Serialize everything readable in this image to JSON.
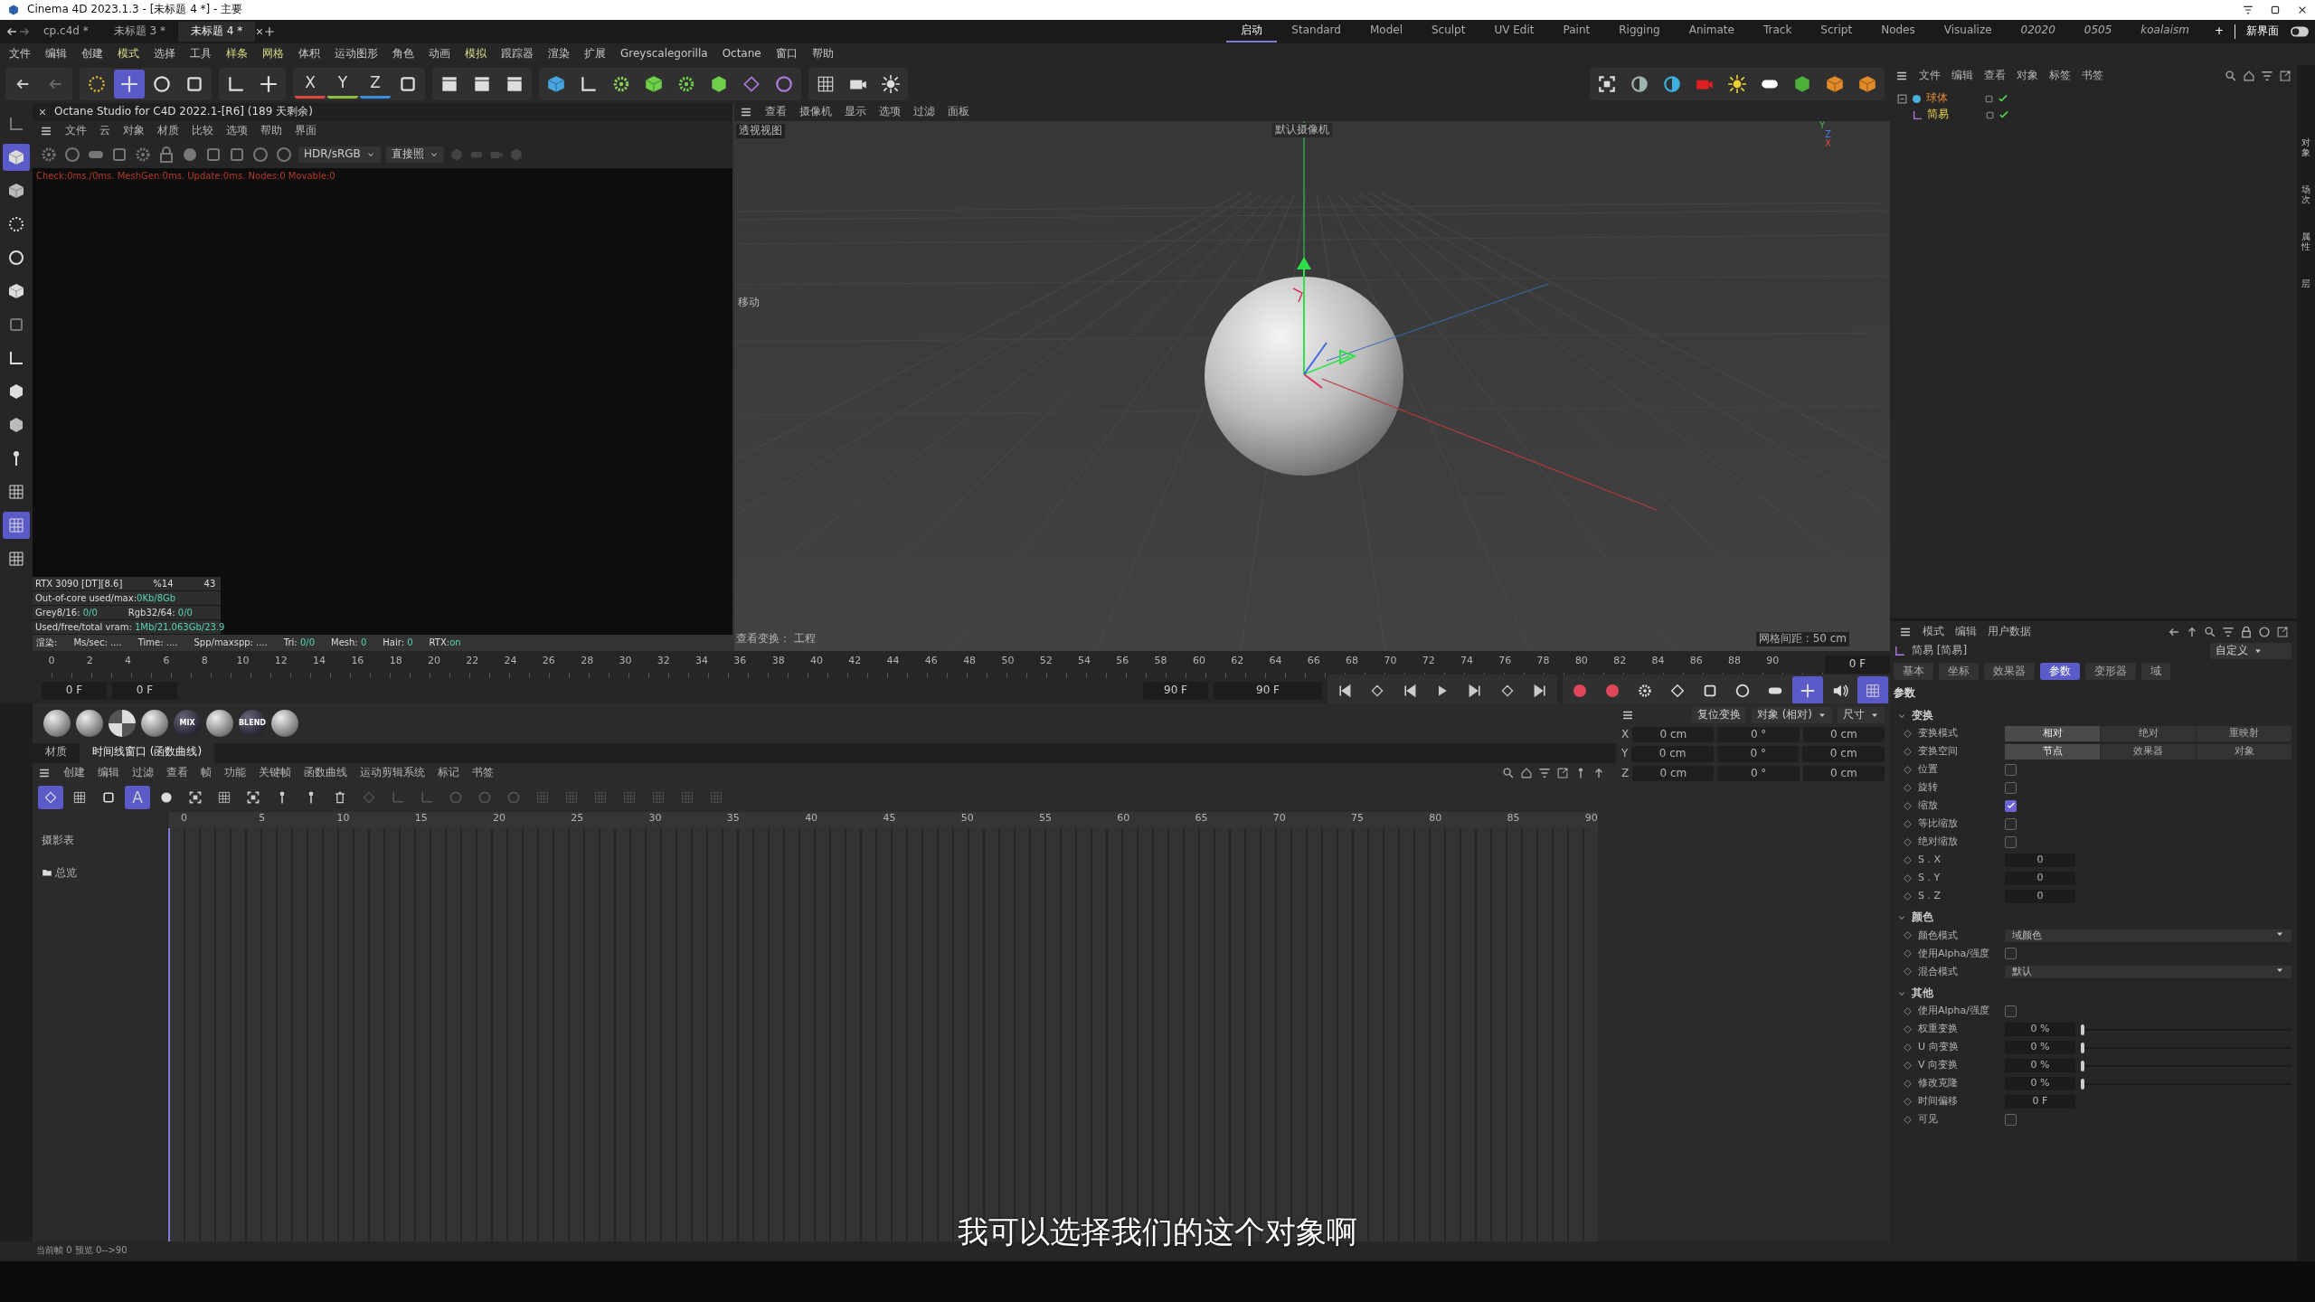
{
  "title_bar": {
    "title": "Cinema 4D 2023.1.3 - [未标题 4 *] - 主要"
  },
  "doc_tabs": [
    {
      "label": "cp.c4d *",
      "selected": false
    },
    {
      "label": "未标题 3 *",
      "selected": false
    },
    {
      "label": "未标题 4 *",
      "selected": true
    }
  ],
  "layouts": [
    {
      "label": "启动",
      "selected": true,
      "kind": "builtin"
    },
    {
      "label": "Standard",
      "selected": false,
      "kind": "builtin"
    },
    {
      "label": "Model",
      "selected": false,
      "kind": "builtin"
    },
    {
      "label": "Sculpt",
      "selected": false,
      "kind": "builtin"
    },
    {
      "label": "UV Edit",
      "selected": false,
      "kind": "builtin"
    },
    {
      "label": "Paint",
      "selected": false,
      "kind": "builtin"
    },
    {
      "label": "Rigging",
      "selected": false,
      "kind": "builtin"
    },
    {
      "label": "Animate",
      "selected": false,
      "kind": "builtin"
    },
    {
      "label": "Track",
      "selected": false,
      "kind": "builtin"
    },
    {
      "label": "Script",
      "selected": false,
      "kind": "builtin"
    },
    {
      "label": "Nodes",
      "selected": false,
      "kind": "builtin"
    },
    {
      "label": "Visualize",
      "selected": false,
      "kind": "builtin"
    },
    {
      "label": "02020",
      "selected": false,
      "kind": "custom"
    },
    {
      "label": "0505",
      "selected": false,
      "kind": "custom"
    },
    {
      "label": "koalaism",
      "selected": false,
      "kind": "custom"
    }
  ],
  "add_layout": "+",
  "new_layout_button": "新界面",
  "menu": [
    {
      "label": "文件",
      "kind": "plain"
    },
    {
      "label": "编辑",
      "kind": "plain"
    },
    {
      "label": "创建",
      "kind": "plain"
    },
    {
      "label": "模式",
      "kind": "accent"
    },
    {
      "label": "选择",
      "kind": "plain"
    },
    {
      "label": "工具",
      "kind": "plain"
    },
    {
      "label": "样条",
      "kind": "accent"
    },
    {
      "label": "网格",
      "kind": "accent"
    },
    {
      "label": "体积",
      "kind": "plain"
    },
    {
      "label": "运动图形",
      "kind": "plain"
    },
    {
      "label": "角色",
      "kind": "plain"
    },
    {
      "label": "动画",
      "kind": "plain"
    },
    {
      "label": "模拟",
      "kind": "accent"
    },
    {
      "label": "跟踪器",
      "kind": "plain"
    },
    {
      "label": "渲染",
      "kind": "plain"
    },
    {
      "label": "扩展",
      "kind": "plain"
    },
    {
      "label": "Greyscalegorilla",
      "kind": "plain"
    },
    {
      "label": "Octane",
      "kind": "plain"
    },
    {
      "label": "窗口",
      "kind": "plain"
    },
    {
      "label": "帮助",
      "kind": "plain"
    }
  ],
  "tools": [
    {
      "selected": false
    },
    {
      "selected": true
    },
    {
      "selected": false
    },
    {
      "selected": false
    }
  ],
  "axis_buttons": [
    {
      "label": "X",
      "color": "#e0443c"
    },
    {
      "label": "Y",
      "color": "#8fc13f"
    },
    {
      "label": "Z",
      "color": "#3c8fe0"
    }
  ],
  "left_tools": [
    {
      "selected": false
    },
    {
      "selected": true
    },
    {
      "selected": false
    },
    {
      "selected": false
    },
    {
      "selected": false
    },
    {
      "selected": false
    },
    {
      "selected": false
    },
    {
      "selected": false
    },
    {
      "selected": false
    },
    {
      "selected": false
    },
    {
      "selected": false
    },
    {
      "selected": false
    },
    {
      "selected": true
    },
    {
      "selected": false
    }
  ],
  "octane": {
    "title": "Octane Studio for C4D 2022.1-[R6] (189 天剩余)",
    "menu": [
      "文件",
      "云",
      "对象",
      "材质",
      "比较",
      "选项",
      "帮助",
      "界面"
    ],
    "view_mode": "HDR/sRGB",
    "render_mode": "直接照",
    "status": "Check:0ms./0ms. MeshGen:0ms. Update:0ms. Nodes:0 Movable:0",
    "stats": [
      [
        {
          "label": "RTX 3090 [DT][8.6]"
        },
        {
          "label": "%14"
        },
        {
          "label": "43"
        }
      ],
      [
        {
          "label": "Out-of-core used/max:",
          "value": "0Kb/8Gb"
        }
      ],
      [
        {
          "label": "Grey8/16: ",
          "value": "0/0"
        },
        {
          "label": "Rgb32/64: ",
          "value": "0/0"
        }
      ],
      [
        {
          "label": "Used/free/total vram: ",
          "value": "1Mb/21.063Gb/23.9"
        }
      ]
    ],
    "render_stats": [
      {
        "label": "渲染:"
      },
      {
        "label": "Ms/sec: ...."
      },
      {
        "label": "Time: ...."
      },
      {
        "label": "Spp/maxspp: ...."
      },
      {
        "label": "Tri: ",
        "value": "0/0"
      },
      {
        "label": "Mesh: ",
        "value": "0"
      },
      {
        "label": "Hair: ",
        "value": "0"
      },
      {
        "label": "RTX:",
        "value": "on"
      }
    ]
  },
  "viewport": {
    "menu": [
      "查看",
      "摄像机",
      "显示",
      "选项",
      "过滤",
      "面板"
    ],
    "view_name": "透视视图",
    "camera": "默认摄像机",
    "tool_hint": "移动",
    "axes": [
      "Y",
      "Z",
      "X"
    ],
    "footer_left": "查看变换： 工程",
    "footer_right": "网格间距 : 50 cm"
  },
  "object_manager": {
    "menu": [
      "文件",
      "编辑",
      "查看",
      "对象",
      "标签",
      "书签"
    ],
    "objects": [
      {
        "name": "球体",
        "selected": false,
        "expanded": true,
        "children": [
          {
            "name": "简易",
            "selected": true
          }
        ]
      }
    ]
  },
  "side_tabs": [
    "对象",
    "场次",
    "属性",
    "层"
  ],
  "timeline": {
    "ruler": [
      "0",
      "2",
      "4",
      "6",
      "8",
      "10",
      "12",
      "14",
      "16",
      "18",
      "20",
      "22",
      "24",
      "26",
      "28",
      "30",
      "32",
      "34",
      "36",
      "38",
      "40",
      "42",
      "44",
      "46",
      "48",
      "50",
      "52",
      "54",
      "56",
      "58",
      "60",
      "62",
      "64",
      "66",
      "68",
      "70",
      "72",
      "74",
      "76",
      "78",
      "80",
      "82",
      "84",
      "86",
      "88",
      "90"
    ],
    "current_frame": "0 F",
    "fields": [
      "0 F",
      "0 F",
      "90 F",
      "90 F"
    ]
  },
  "materials": [
    {
      "kind": "plain"
    },
    {
      "kind": "plain"
    },
    {
      "kind": "checker"
    },
    {
      "kind": "plain"
    },
    {
      "kind": "mix",
      "label": "MIX"
    },
    {
      "kind": "plain"
    },
    {
      "kind": "mix",
      "label": "BLEND"
    },
    {
      "kind": "plain"
    }
  ],
  "panel_tabs": [
    {
      "label": "材质",
      "selected": false
    },
    {
      "label": "时间线窗口 (函数曲线)",
      "selected": true
    }
  ],
  "timeline_menu": [
    "创建",
    "编辑",
    "过滤",
    "查看",
    "帧",
    "功能",
    "关键帧",
    "函数曲线",
    "运动剪辑系统",
    "标记",
    "书签"
  ],
  "timeline_tools": [
    {
      "selected": true
    },
    {
      "selected": false
    },
    {
      "selected": false
    },
    {
      "selected": true
    },
    {
      "selected": false
    }
  ],
  "timeline_letter": "A",
  "dopesheet": {
    "sheet_label": "摄影表",
    "folder": "总览",
    "ruler": [
      "0",
      "5",
      "10",
      "15",
      "20",
      "25",
      "30",
      "35",
      "40",
      "45",
      "50",
      "55",
      "60",
      "65",
      "70",
      "75",
      "80",
      "85",
      "90"
    ]
  },
  "coordinates": {
    "reset": "复位变换",
    "mode": "对象 (相对)",
    "size_mode": "尺寸",
    "rows": [
      {
        "axis": "X",
        "values": [
          "0 cm",
          "0 °",
          "0 cm"
        ]
      },
      {
        "axis": "Y",
        "values": [
          "0 cm",
          "0 °",
          "0 cm"
        ]
      },
      {
        "axis": "Z",
        "values": [
          "0 cm",
          "0 °",
          "0 cm"
        ]
      }
    ]
  },
  "attributes": {
    "menu": [
      "模式",
      "编辑",
      "用户数据"
    ],
    "object_title": "简易 [简易]",
    "preset": "自定义",
    "tabs": [
      {
        "label": "基本",
        "selected": false
      },
      {
        "label": "坐标",
        "selected": false
      },
      {
        "label": "效果器",
        "selected": false
      },
      {
        "label": "参数",
        "selected": true
      },
      {
        "label": "变形器",
        "selected": false
      },
      {
        "label": "域",
        "selected": false
      }
    ],
    "section": "参数",
    "groups": [
      {
        "title": "变换",
        "expanded": true,
        "rows": [
          {
            "kind": "segmented",
            "label": "变换模式",
            "options": [
              {
                "label": "相对",
                "selected": true
              },
              {
                "label": "绝对",
                "selected": false
              },
              {
                "label": "重映射",
                "selected": false
              }
            ]
          },
          {
            "kind": "segmented",
            "label": "变换空间",
            "options": [
              {
                "label": "节点",
                "selected": true
              },
              {
                "label": "效果器",
                "selected": false
              },
              {
                "label": "对象",
                "selected": false
              }
            ]
          },
          {
            "kind": "checkbox",
            "label": "位置",
            "checked": false
          },
          {
            "kind": "checkbox",
            "label": "旋转",
            "checked": false
          },
          {
            "kind": "checkbox",
            "label": "缩放",
            "checked": true
          },
          {
            "kind": "checkbox",
            "label": "等比缩放",
            "checked": false
          },
          {
            "kind": "checkbox",
            "label": "绝对缩放",
            "checked": false
          },
          {
            "kind": "number",
            "label": "S . X",
            "value": "0"
          },
          {
            "kind": "number",
            "label": "S . Y",
            "value": "0"
          },
          {
            "kind": "number",
            "label": "S . Z",
            "value": "0"
          }
        ]
      },
      {
        "title": "颜色",
        "expanded": true,
        "rows": [
          {
            "kind": "dropdown",
            "label": "颜色模式",
            "value": "域颜色"
          },
          {
            "kind": "checkbox",
            "label": "使用Alpha/强度",
            "checked": false
          },
          {
            "kind": "dropdown",
            "label": "混合模式",
            "value": "默认"
          }
        ]
      },
      {
        "title": "其他",
        "expanded": true,
        "rows": [
          {
            "kind": "checkbox",
            "label": "使用Alpha/强度",
            "checked": false
          },
          {
            "kind": "slider",
            "label": "权重变换",
            "value": "0 %",
            "level": 0
          },
          {
            "kind": "slider",
            "label": "U 向变换",
            "value": "0 %",
            "level": 0
          },
          {
            "kind": "slider",
            "label": "V 向变换",
            "value": "0 %",
            "level": 0
          },
          {
            "kind": "slider",
            "label": "修改克隆",
            "value": "0 %",
            "level": 0
          },
          {
            "kind": "number",
            "label": "时间偏移",
            "value": "0 F"
          },
          {
            "kind": "checkbox",
            "label": "可见",
            "checked": false
          }
        ]
      }
    ]
  },
  "status_bar": "当前帧 0 预览 0-->90",
  "subtitle": "我可以选择我们的这个对象啊"
}
